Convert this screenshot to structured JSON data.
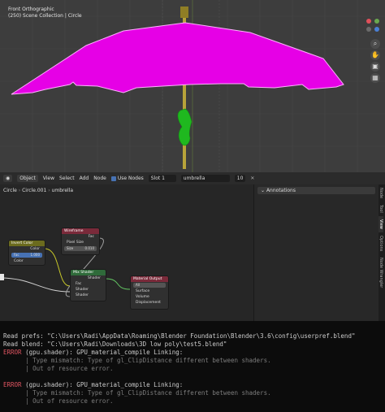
{
  "viewport": {
    "view_name": "Front Orthographic",
    "collection_info": "(250) Scene Collection | Circle",
    "colors": {
      "background": "#3d3d3d",
      "umbrella_canopy": "#e600e6",
      "handle_green": "#1fb81f",
      "shaft_yellow": "#b8a33a"
    },
    "nav_icons": [
      "axis-gizmo-icon",
      "zoom-icon",
      "hand-pan-icon",
      "camera-icon",
      "grid-icon"
    ]
  },
  "node_header": {
    "editor_type": "Object",
    "menus": [
      "View",
      "Select",
      "Add",
      "Node"
    ],
    "use_nodes_label": "Use Nodes",
    "slot": "Slot 1",
    "material": "umbrella",
    "user_count": "10"
  },
  "node_editor": {
    "breadcrumb": [
      "Circle",
      "Circle.001",
      "umbrella"
    ],
    "nodes": {
      "invert_color": {
        "title": "Invert Color",
        "output": "Color",
        "fac_label": "Fac",
        "fac_value": "1.000",
        "input": "Color"
      },
      "wireframe": {
        "title": "Wireframe",
        "output": "Fac",
        "pixel_size": "Pixel Size",
        "size_label": "Size",
        "size_value": "0.010"
      },
      "mix_shader": {
        "title": "Mix Shader",
        "output": "Shader",
        "inputs": [
          "Fac",
          "Shader",
          "Shader"
        ]
      },
      "material_output": {
        "title": "Material Output",
        "target": "All",
        "inputs": [
          "Surface",
          "Volume",
          "Displacement"
        ]
      }
    }
  },
  "right_panel": {
    "annotations_label": "Annotations",
    "tabs": [
      "Node",
      "Tool",
      "View",
      "Options",
      "Node Wrangler"
    ]
  },
  "console": {
    "lines": [
      {
        "type": "normal",
        "text": "Read prefs: \"C:\\Users\\Radi\\AppData\\Roaming\\Blender Foundation\\Blender\\3.6\\config\\userpref.blend\""
      },
      {
        "type": "normal",
        "text": "Read blend: \"C:\\Users\\Radi\\Downloads\\3D low poly\\test5.blend\""
      },
      {
        "type": "error",
        "label": "ERROR",
        "text": " (gpu.shader): GPU_material_compile Linking:"
      },
      {
        "type": "detail",
        "text": "      | Type mismatch: Type of gl_ClipDistance different between shaders."
      },
      {
        "type": "detail",
        "text": "      | Out of resource error."
      },
      {
        "type": "blank",
        "text": ""
      },
      {
        "type": "error",
        "label": "ERROR",
        "text": " (gpu.shader): GPU_material_compile Linking:"
      },
      {
        "type": "detail",
        "text": "      | Type mismatch: Type of gl_ClipDistance different between shaders."
      },
      {
        "type": "detail",
        "text": "      | Out of resource error."
      }
    ]
  }
}
